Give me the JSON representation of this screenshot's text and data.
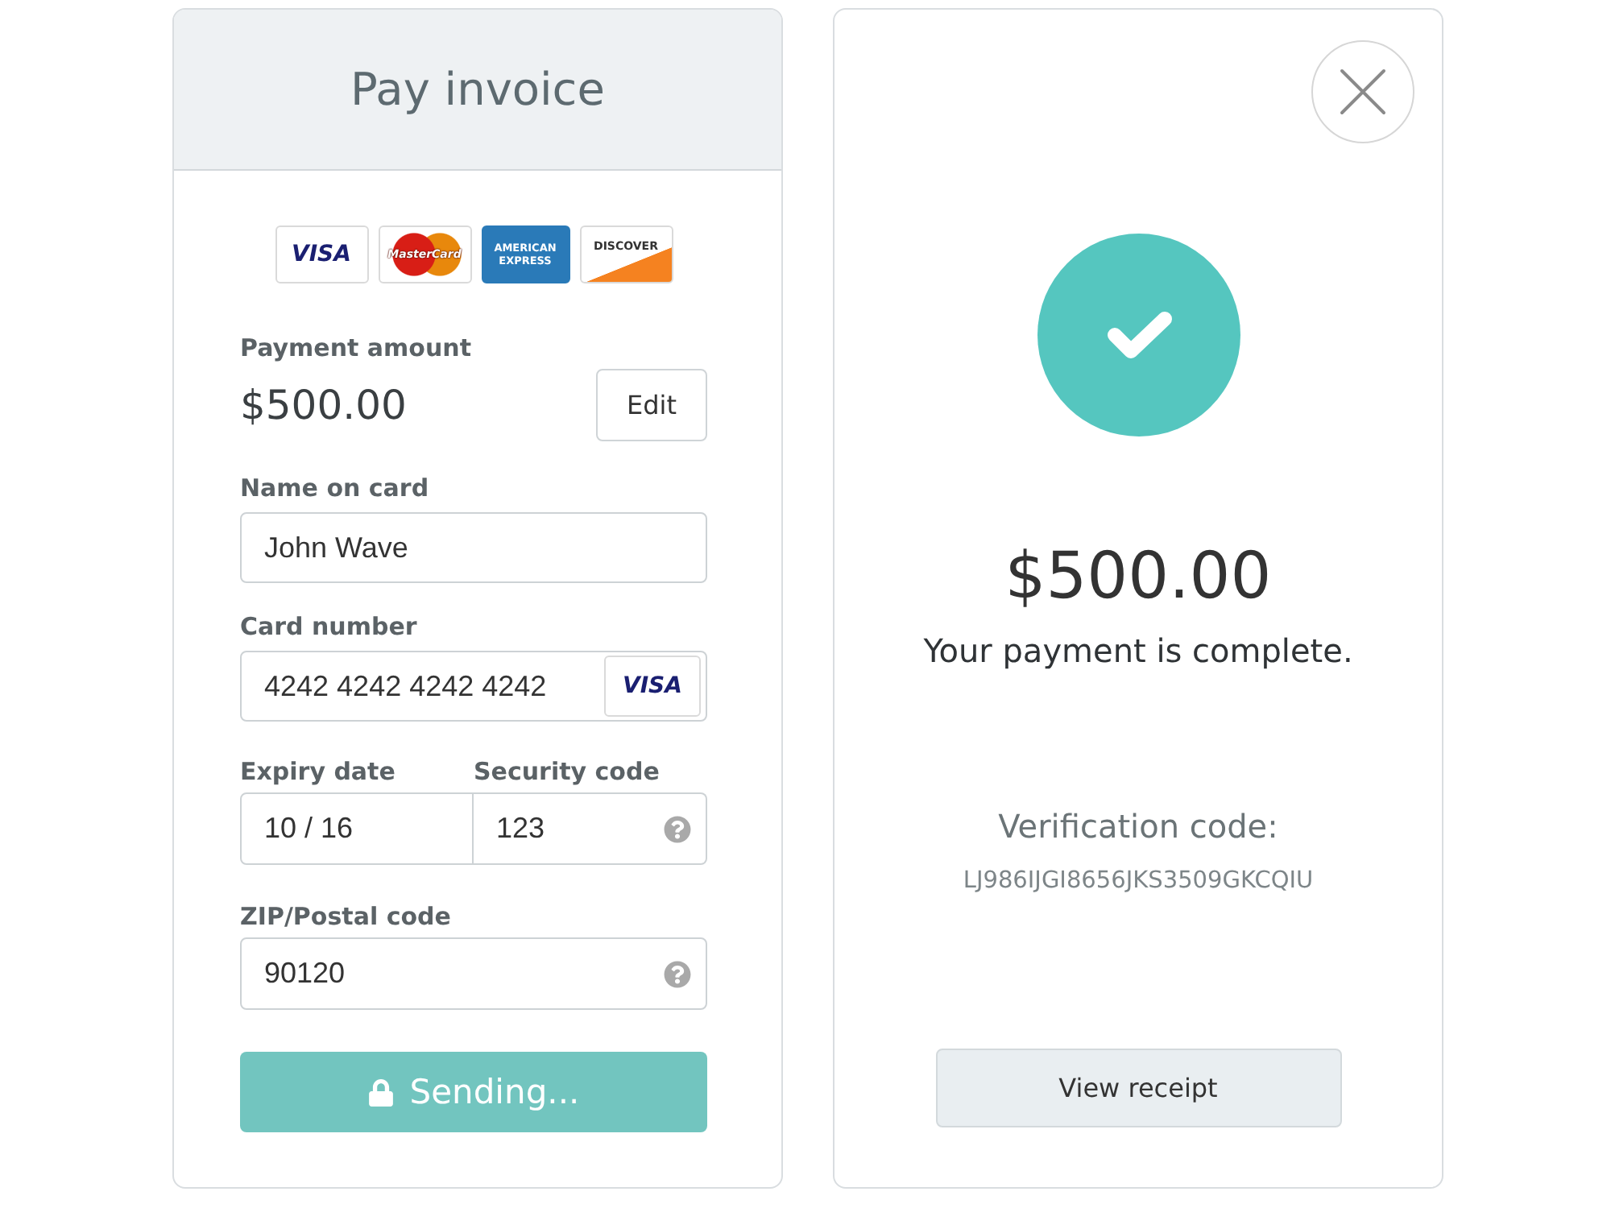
{
  "payment_form": {
    "title": "Pay invoice",
    "card_brands": [
      {
        "kind": "visa",
        "label": "VISA"
      },
      {
        "kind": "mastercard",
        "label": "MasterCard"
      },
      {
        "kind": "amex",
        "label": "AMERICAN EXPRESS"
      },
      {
        "kind": "discover",
        "label": "DISCOVER"
      }
    ],
    "amount": {
      "label": "Payment amount",
      "value": "$500.00",
      "edit_button": "Edit"
    },
    "name_on_card": {
      "label": "Name on card",
      "value": "John Wave"
    },
    "card_number": {
      "label": "Card number",
      "value": "4242 4242 4242 4242",
      "brand_badge": "VISA"
    },
    "expiry_date": {
      "label": "Expiry date",
      "value": "10 / 16"
    },
    "security_code": {
      "label": "Security code",
      "value": "123",
      "help": true
    },
    "zip_code": {
      "label": "ZIP/Postal code",
      "value": "90120",
      "help": true
    },
    "submit_button": {
      "label": "Sending...",
      "disabled": true
    }
  },
  "confirmation": {
    "amount": "$500.00",
    "message": "Your payment is complete.",
    "verification_label": "Verification code:",
    "verification_code": "LJ986IJGI8656JKS3509GKCQIU",
    "receipt_button": "View receipt"
  }
}
